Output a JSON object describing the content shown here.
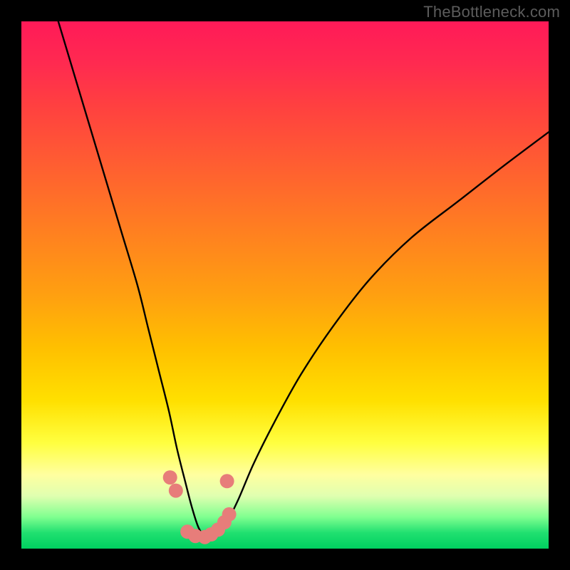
{
  "watermark": "TheBottleneck.com",
  "colors": {
    "frame": "#000000",
    "curve_stroke": "#000000",
    "marker_fill": "#e77d7a",
    "marker_stroke": "#cf5b58"
  },
  "chart_data": {
    "type": "line",
    "title": "",
    "xlabel": "",
    "ylabel": "",
    "xlim": [
      0,
      100
    ],
    "ylim": [
      0,
      100
    ],
    "note": "No axis ticks or numeric labels are visible in the image; x/y values below are estimated from pixel positions on a 0–100 normalized grid.",
    "series": [
      {
        "name": "curve",
        "x": [
          7,
          10,
          13,
          16,
          19,
          22,
          24,
          26,
          28,
          29.5,
          31,
          32.3,
          33.6,
          35,
          36.5,
          38.4,
          41,
          44,
          48,
          53,
          59,
          66,
          74,
          83,
          92,
          100
        ],
        "y": [
          100,
          90,
          80,
          70,
          60,
          50,
          42,
          34,
          26,
          19,
          13,
          8,
          4,
          2,
          2,
          4,
          9,
          16,
          24,
          33,
          42,
          51,
          59,
          66,
          73,
          79
        ]
      }
    ],
    "markers": [
      {
        "x": 28.2,
        "y": 13.5
      },
      {
        "x": 29.3,
        "y": 11.0
      },
      {
        "x": 31.5,
        "y": 3.2
      },
      {
        "x": 33.0,
        "y": 2.4
      },
      {
        "x": 34.8,
        "y": 2.2
      },
      {
        "x": 36.0,
        "y": 2.7
      },
      {
        "x": 37.3,
        "y": 3.6
      },
      {
        "x": 38.5,
        "y": 5.0
      },
      {
        "x": 39.4,
        "y": 6.5
      },
      {
        "x": 39.0,
        "y": 12.8
      }
    ]
  }
}
